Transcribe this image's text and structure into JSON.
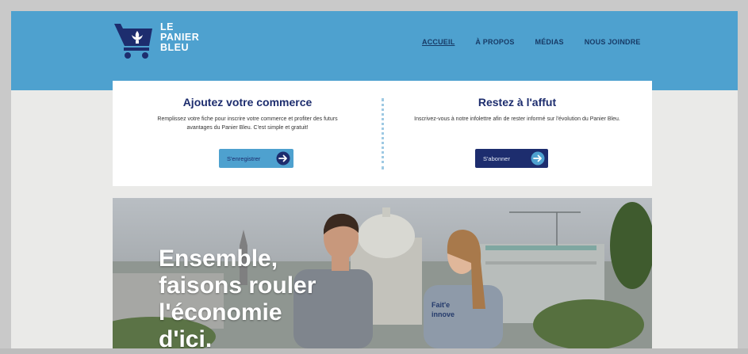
{
  "header": {
    "logo_lines": [
      "LE",
      "PANIER",
      "BLEU"
    ],
    "nav": [
      {
        "label": "ACCUEIL",
        "active": true
      },
      {
        "label": "À PROPOS",
        "active": false
      },
      {
        "label": "MÉDIAS",
        "active": false
      },
      {
        "label": "NOUS JOINDRE",
        "active": false
      }
    ]
  },
  "cards": {
    "left": {
      "title": "Ajoutez votre commerce",
      "description": "Remplissez votre fiche pour inscrire votre commerce et profiter des futurs avantages du Panier Bleu. C'est simple et gratuit!",
      "button_label": "S'enregistrer"
    },
    "right": {
      "title": "Restez à l'affut",
      "description": "Inscrivez-vous à notre infolettre afin de rester informé sur l'évolution du Panier Bleu.",
      "button_label": "S'abonner"
    }
  },
  "hero": {
    "headline_lines": [
      "Ensemble,",
      "faisons rouler",
      "l'économie",
      "d'ici."
    ],
    "shirt_text": [
      "Fait'e",
      "innove"
    ]
  },
  "colors": {
    "header_blue": "#4ea1cf",
    "navy": "#1d2d6e",
    "page_bg": "#eaeae8"
  },
  "icons": [
    "cart-fleur-de-lis-icon",
    "arrow-right-circle-icon"
  ]
}
